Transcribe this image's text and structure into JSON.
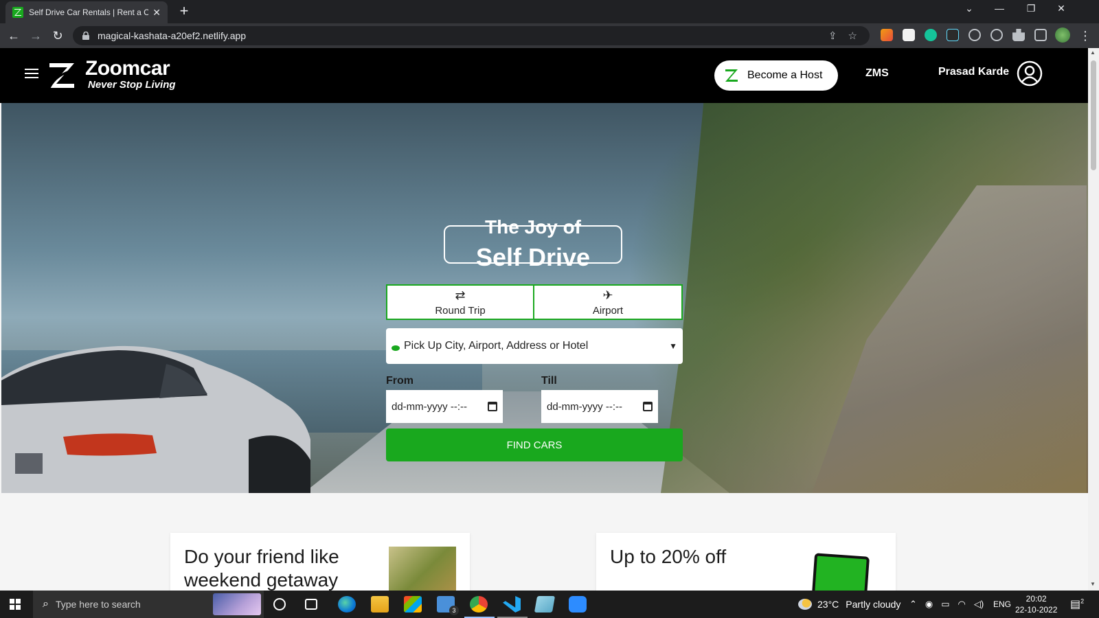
{
  "browser": {
    "tab_title": "Self Drive Car Rentals | Rent a Car",
    "tab_close": "✕",
    "new_tab": "+",
    "url": "magical-kashata-a20ef2.netlify.app"
  },
  "site": {
    "logo_name": "Zoomcar",
    "logo_tagline": "Never Stop Living",
    "host_button": "Become a Host",
    "zms_link": "ZMS",
    "user_name": "Prasad Karde"
  },
  "hero": {
    "title_line1": "The Joy of",
    "title_line2": "Self Drive",
    "trip_tabs": [
      {
        "label": "Round Trip",
        "icon": "⇄"
      },
      {
        "label": "Airport",
        "icon": "✈"
      }
    ],
    "city_placeholder": "Pick Up City, Airport, Address or Hotel",
    "from_label": "From",
    "till_label": "Till",
    "from_value": "dd-mm-yyyy --:--",
    "till_value": "dd-mm-yyyy --:--",
    "find_button": "FIND CARS"
  },
  "cards": [
    {
      "title": "Do your friend like weekend getaway"
    },
    {
      "title": "Up to 20% off"
    }
  ],
  "taskbar": {
    "search_placeholder": "Type here to search",
    "mail_badge": "3",
    "weather_temp": "23°C",
    "weather_desc": "Partly cloudy",
    "language": "ENG",
    "time": "20:02",
    "date": "22-10-2022",
    "notifications": "2"
  },
  "colors": {
    "brand_green": "#19a81e",
    "header_bg": "#000000"
  }
}
